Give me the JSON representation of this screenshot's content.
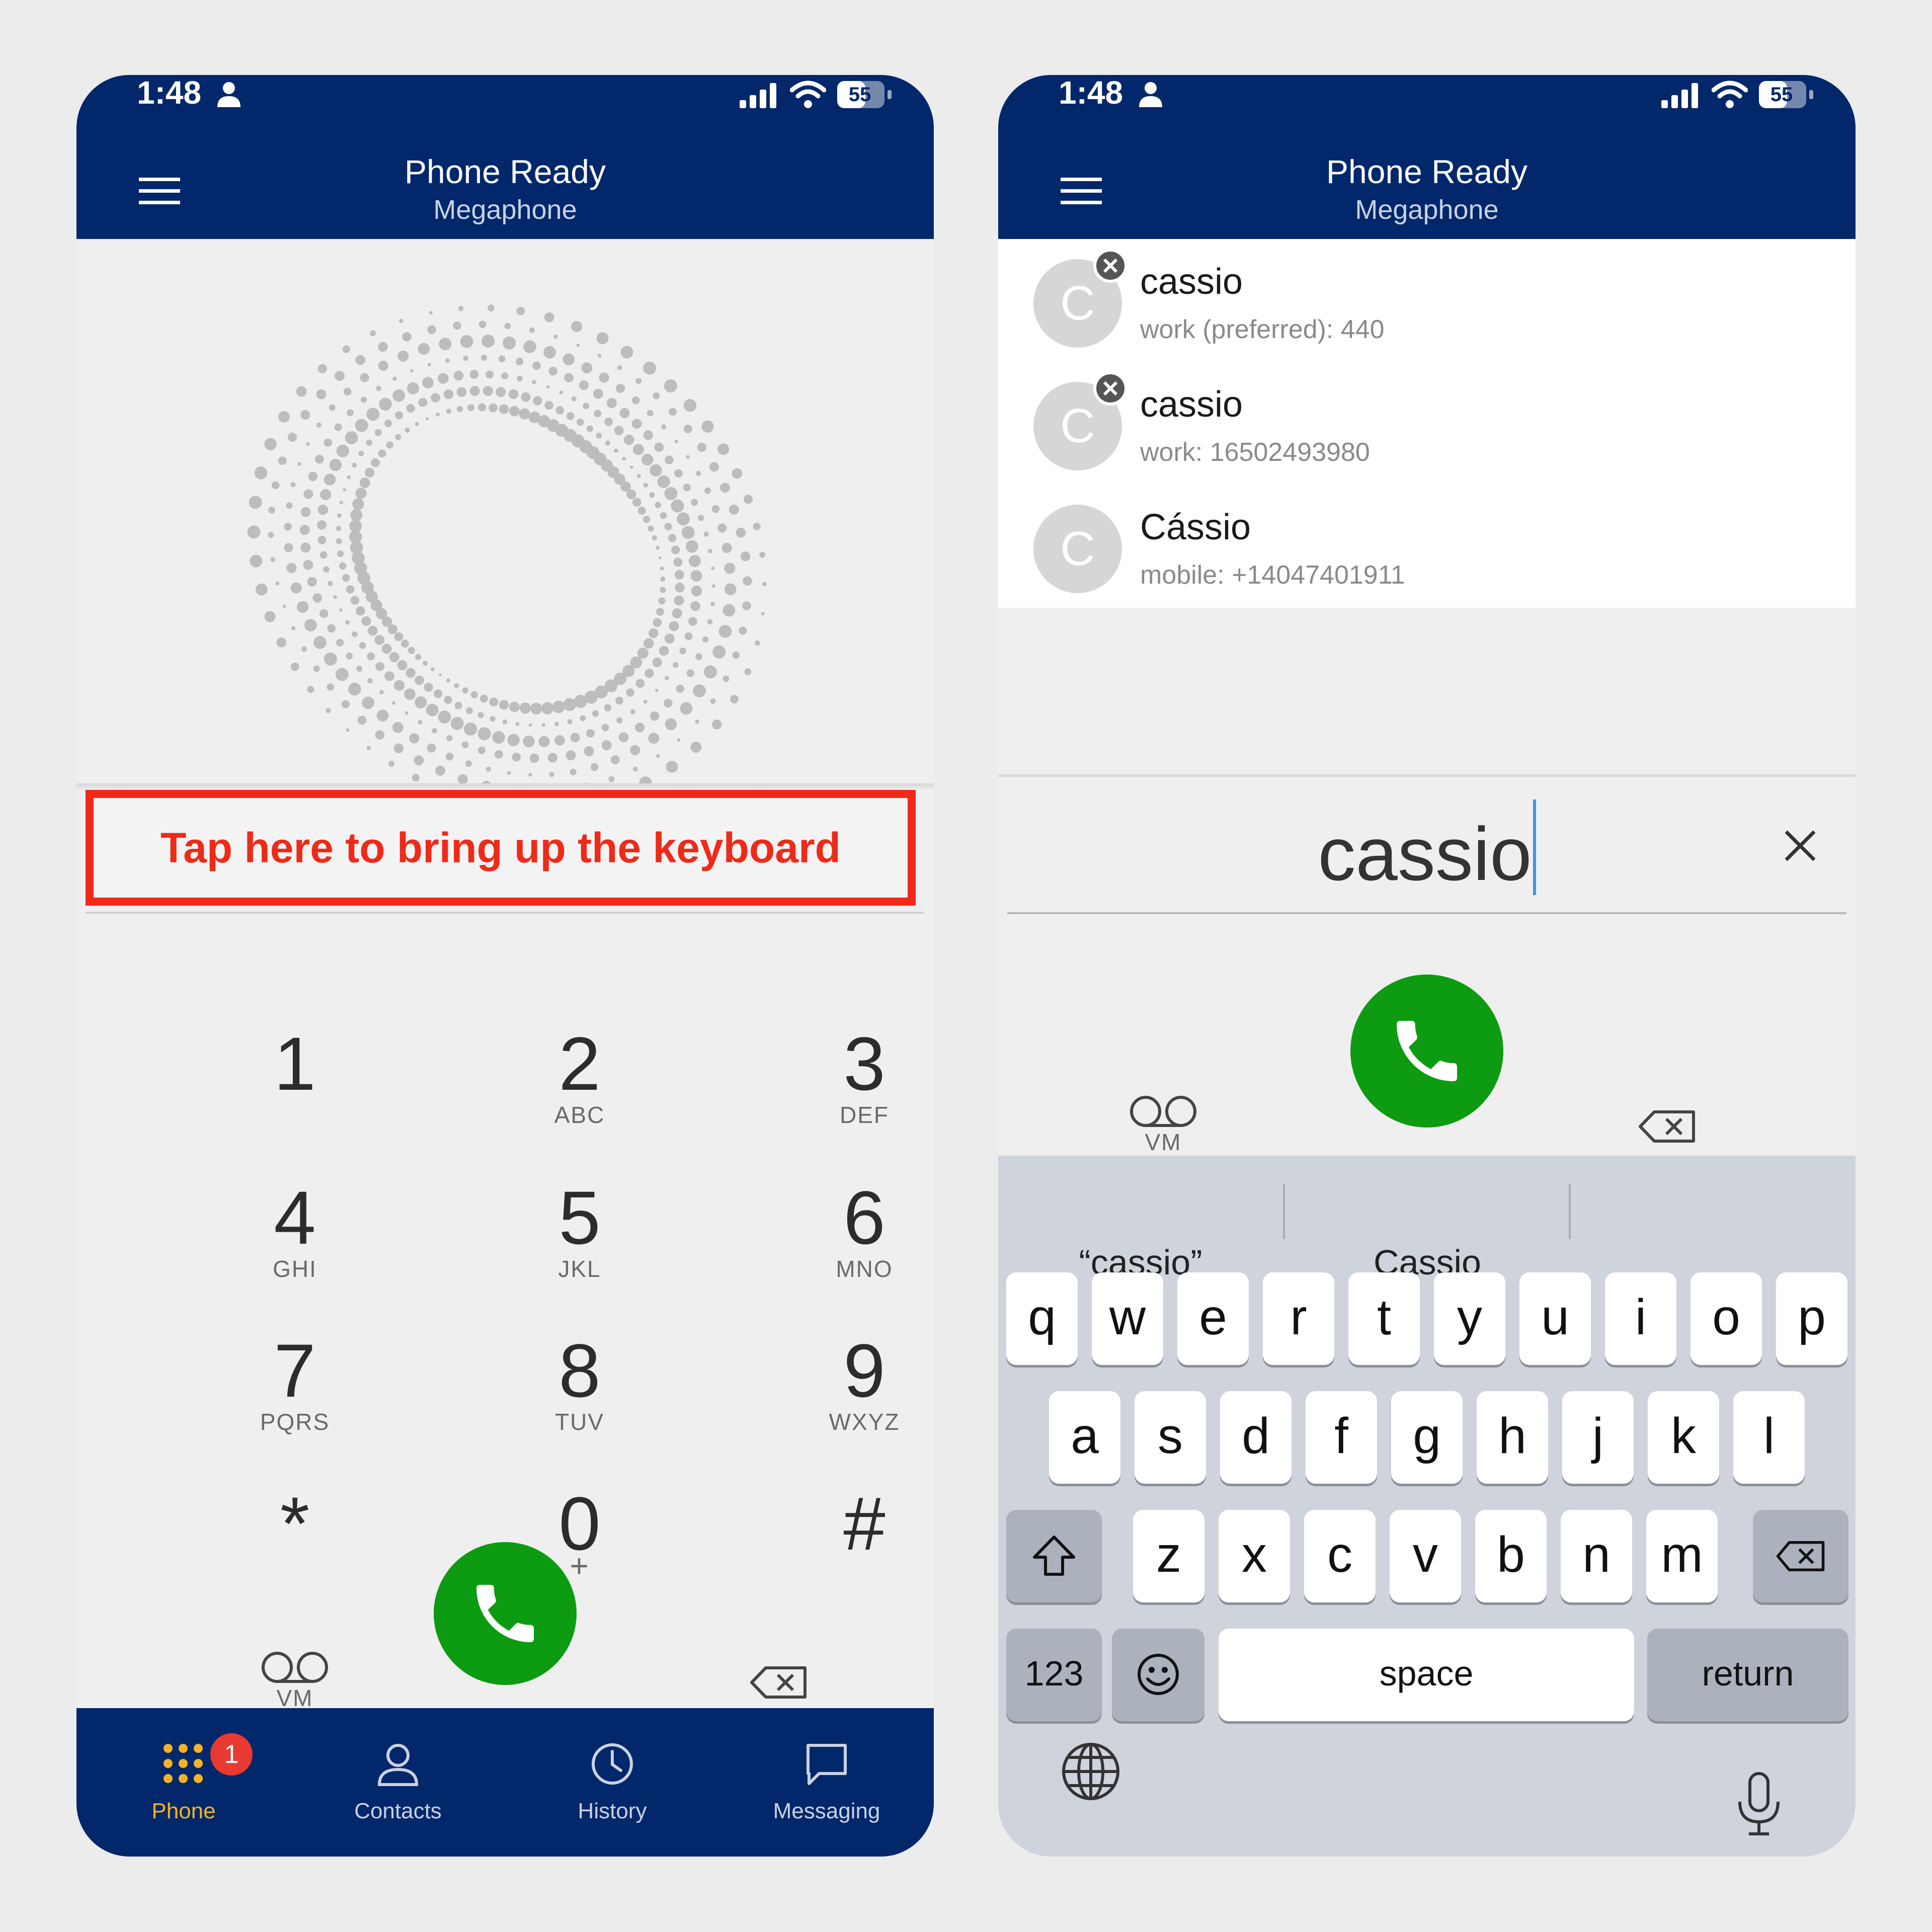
{
  "status_bar": {
    "time": "1:48",
    "battery": "55"
  },
  "header": {
    "title": "Phone Ready",
    "subtitle": "Megaphone"
  },
  "left": {
    "hint": "Tap here to bring up the keyboard",
    "dialpad": [
      {
        "digit": "1",
        "letters": ""
      },
      {
        "digit": "2",
        "letters": "ABC"
      },
      {
        "digit": "3",
        "letters": "DEF"
      },
      {
        "digit": "4",
        "letters": "GHI"
      },
      {
        "digit": "5",
        "letters": "JKL"
      },
      {
        "digit": "6",
        "letters": "MNO"
      },
      {
        "digit": "7",
        "letters": "PQRS"
      },
      {
        "digit": "8",
        "letters": "TUV"
      },
      {
        "digit": "9",
        "letters": "WXYZ"
      },
      {
        "digit": "*",
        "letters": ""
      },
      {
        "digit": "0",
        "letters": "+"
      },
      {
        "digit": "#",
        "letters": ""
      }
    ],
    "vm_label": "VM",
    "tabs": [
      {
        "label": "Phone",
        "icon": "dialpad-icon",
        "active": true,
        "badge": "1"
      },
      {
        "label": "Contacts",
        "icon": "person-icon",
        "active": false
      },
      {
        "label": "History",
        "icon": "clock-icon",
        "active": false
      },
      {
        "label": "Messaging",
        "icon": "message-icon",
        "active": false
      }
    ]
  },
  "right": {
    "contacts": [
      {
        "initial": "C",
        "name": "cassio",
        "detail": "work (preferred): 440",
        "removable": true
      },
      {
        "initial": "C",
        "name": "cassio",
        "detail": "work: 16502493980",
        "removable": true
      },
      {
        "initial": "C",
        "name": "Cássio",
        "detail": "mobile: +14047401911",
        "removable": false
      }
    ],
    "input_value": "cassio",
    "vm_label": "VM",
    "suggestions": [
      "“cassio”",
      "Cassio",
      ""
    ],
    "keyboard": {
      "row1": [
        "q",
        "w",
        "e",
        "r",
        "t",
        "y",
        "u",
        "i",
        "o",
        "p"
      ],
      "row2": [
        "a",
        "s",
        "d",
        "f",
        "g",
        "h",
        "j",
        "k",
        "l"
      ],
      "row3": [
        "z",
        "x",
        "c",
        "v",
        "b",
        "n",
        "m"
      ],
      "numbers_key": "123",
      "space_key": "space",
      "return_key": "return"
    }
  },
  "colors": {
    "header_bg": "#02276a",
    "call_green": "#0d9b12",
    "hint_red": "#f2281b",
    "tab_active": "#f5b225",
    "badge_red": "#e83a30"
  }
}
